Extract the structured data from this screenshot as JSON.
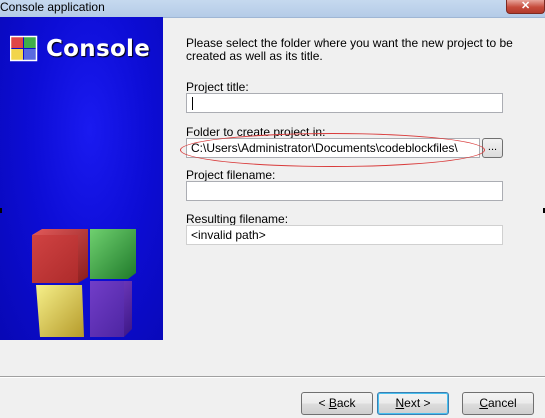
{
  "window": {
    "title": "Console application"
  },
  "banner": {
    "logo_text": "Console",
    "icon": "codeblocks-cube-icon"
  },
  "form": {
    "intro_text": "Please select the folder where you want the new project to be created as well as its title.",
    "project_title": {
      "label": "Project title:",
      "value": ""
    },
    "folder": {
      "label": "Folder to create project in:",
      "value": "C:\\Users\\Administrator\\Documents\\codeblockfiles\\",
      "browse_label": "..."
    },
    "project_filename": {
      "label": "Project filename:",
      "value": ""
    },
    "resulting_filename": {
      "label": "Resulting filename:",
      "value": "<invalid path>"
    }
  },
  "buttons": {
    "back": {
      "mnemonic": "B",
      "rest": "ack",
      "prefix": "< "
    },
    "next": {
      "mnemonic": "N",
      "rest": "ext >"
    },
    "cancel": {
      "mnemonic": "C",
      "rest": "ancel"
    }
  },
  "colors": {
    "banner_blue": "#0d0dd6",
    "highlight_oval": "#d93b3b"
  }
}
